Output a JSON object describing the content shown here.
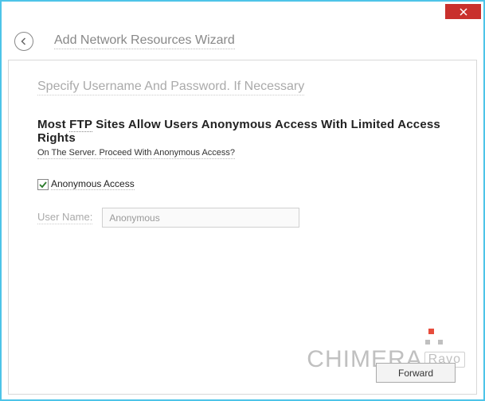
{
  "wizard": {
    "title": "Add Network Resources Wizard"
  },
  "heading": "Specify Username And Password. If Necessary",
  "bold_line_prefix": "Most ",
  "bold_line_ftp": "FTP",
  "bold_line_rest": " Sites Allow Users Anonymous Access With Limited Access Rights",
  "sub_line": "On The Server. Proceed With Anonymous Access?",
  "checkbox": {
    "label": "Anonymous Access",
    "checked": true
  },
  "username": {
    "label": "User Name:",
    "value": "Anonymous"
  },
  "buttons": {
    "forward": "Forward"
  },
  "watermark": {
    "main": "CHIMERA",
    "sub": "Ravo"
  }
}
